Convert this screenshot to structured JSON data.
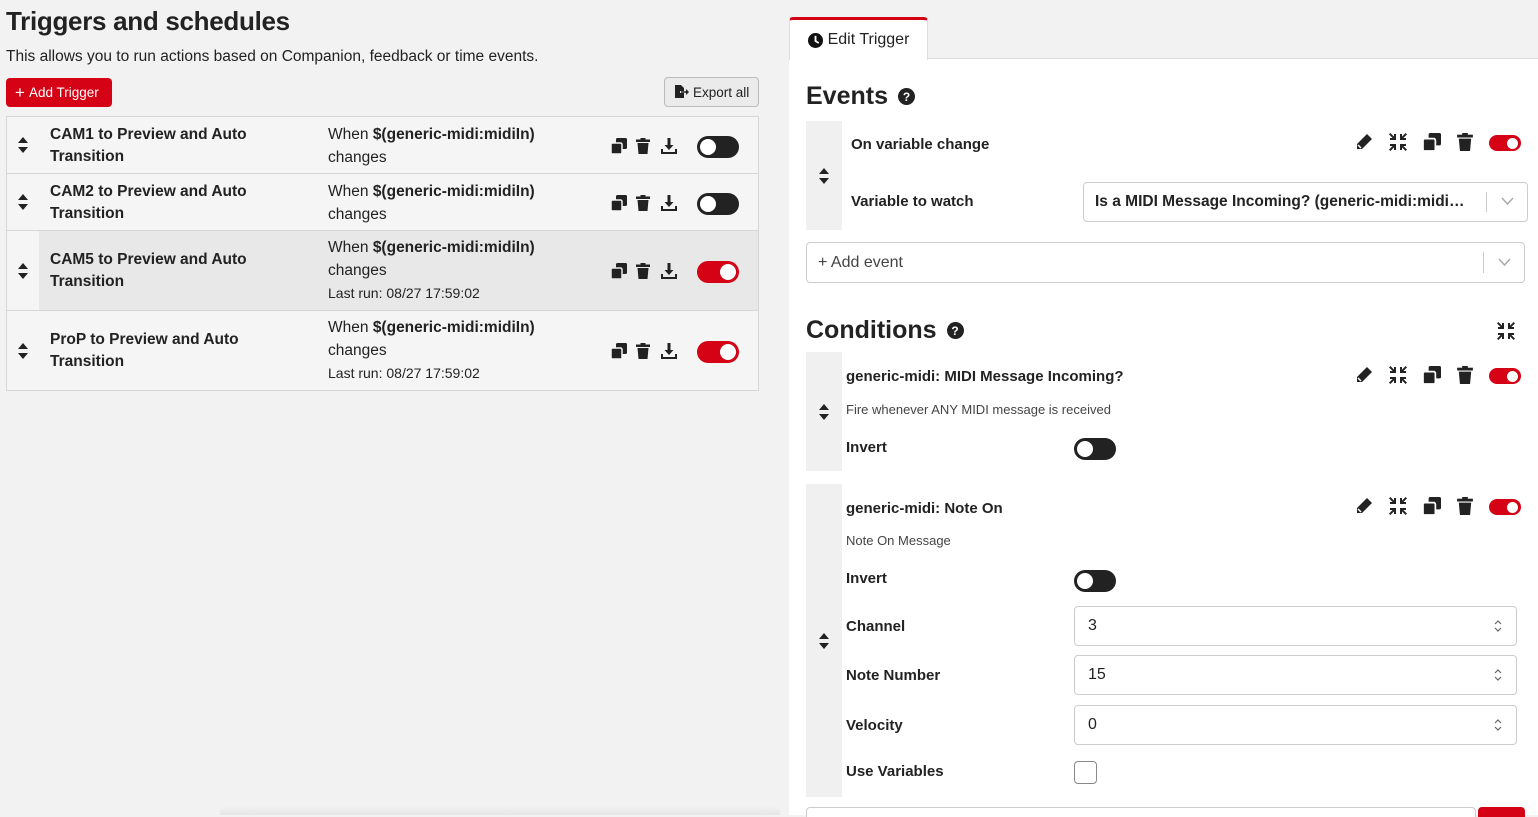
{
  "page": {
    "title": "Triggers and schedules",
    "description": "This allows you to run actions based on Companion, feedback or time events.",
    "add_trigger_label": "Add Trigger",
    "export_all_label": "Export all"
  },
  "triggers": [
    {
      "name": "CAM1 to Preview and Auto Transition",
      "when": "When",
      "variable": "$(generic-midi:midiIn)",
      "changes": "changes",
      "last_run": "",
      "enabled": false
    },
    {
      "name": "CAM2 to Preview and Auto Transition",
      "when": "When",
      "variable": "$(generic-midi:midiIn)",
      "changes": "changes",
      "last_run": "",
      "enabled": false
    },
    {
      "name": "CAM5 to Preview and Auto Transition",
      "when": "When",
      "variable": "$(generic-midi:midiIn)",
      "changes": "changes",
      "last_run": "Last run: 08/27 17:59:02",
      "enabled": true
    },
    {
      "name": "ProP to Preview and Auto Transition",
      "when": "When",
      "variable": "$(generic-midi:midiIn)",
      "changes": "changes",
      "last_run": "Last run: 08/27 17:59:02",
      "enabled": true
    }
  ],
  "editor": {
    "tab_label": "Edit Trigger",
    "events_title": "Events",
    "event": {
      "name": "On variable change",
      "field_label": "Variable to watch",
      "field_value": "Is a MIDI Message Incoming? (generic-midi:midi…"
    },
    "add_event_placeholder": "+ Add event",
    "conditions_title": "Conditions",
    "conditions": [
      {
        "name": "generic-midi: MIDI Message Incoming?",
        "description": "Fire whenever ANY MIDI message is received",
        "invert_label": "Invert"
      },
      {
        "name": "generic-midi: Note On",
        "description": "Note On Message",
        "invert_label": "Invert",
        "channel_label": "Channel",
        "channel_value": "3",
        "note_label": "Note Number",
        "note_value": "15",
        "velocity_label": "Velocity",
        "velocity_value": "0",
        "use_variables_label": "Use Variables"
      }
    ]
  },
  "colors": {
    "accent": "#d50215",
    "dark": "#222222"
  }
}
